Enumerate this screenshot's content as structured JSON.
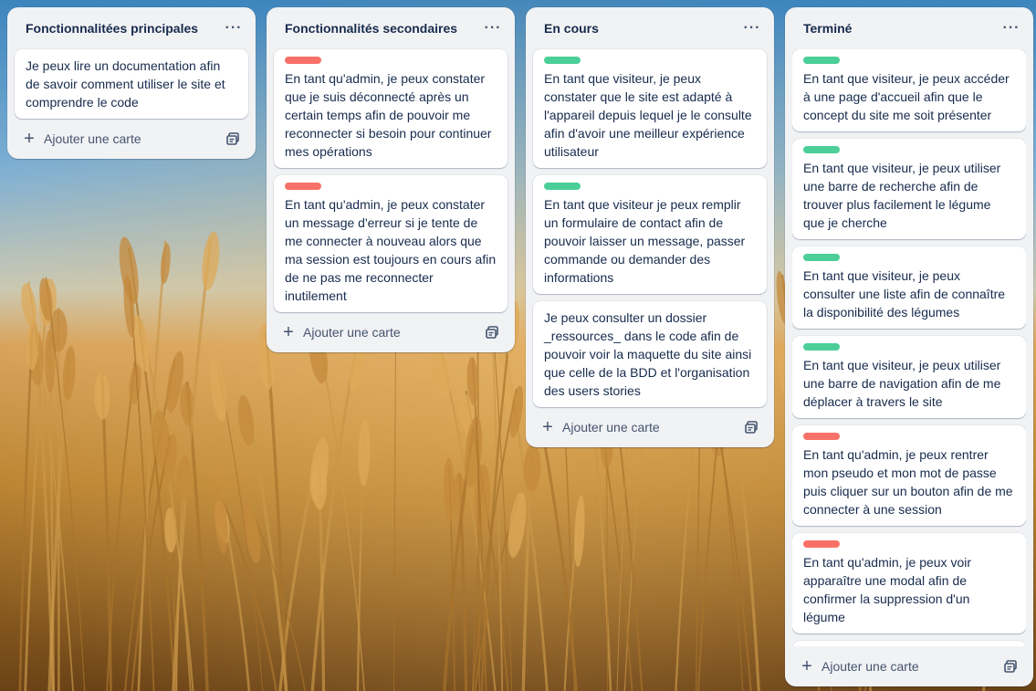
{
  "board": {
    "add_card_label": "Ajouter une carte",
    "menu_glyph": "···",
    "label_colors": {
      "red": "#f87168",
      "green": "#4bce97"
    }
  },
  "lists": [
    {
      "title": "Fonctionnalitées principales",
      "cards": [
        {
          "label": null,
          "text": "Je peux lire un documentation afin de savoir comment utiliser le site et comprendre le code"
        }
      ]
    },
    {
      "title": "Fonctionnalités secondaires",
      "cards": [
        {
          "label": "red",
          "text": "En tant qu'admin, je peux constater que je suis déconnecté après un certain temps afin de pouvoir me reconnecter si besoin pour continuer mes opérations"
        },
        {
          "label": "red",
          "text": "En tant qu'admin, je peux constater un message d'erreur si je tente de me connecter à nouveau alors que ma session est toujours en cours afin de ne pas me reconnecter inutilement"
        }
      ]
    },
    {
      "title": "En cours",
      "cards": [
        {
          "label": "green",
          "text": "En tant que visiteur, je peux constater que le site est adapté à l'appareil depuis lequel je le consulte afin d'avoir une meilleur expérience utilisateur"
        },
        {
          "label": "green",
          "text": "En tant que visiteur je peux remplir un formulaire de contact afin de pouvoir laisser un message, passer commande ou demander des informations"
        },
        {
          "label": null,
          "text": "Je peux consulter un dossier _ressources_ dans le code afin de pouvoir voir la maquette du site ainsi que celle de la BDD et l'organisation des users stories"
        }
      ]
    },
    {
      "title": "Terminé",
      "cards": [
        {
          "label": "green",
          "text": "En tant que visiteur, je peux accéder à une page d'accueil afin que le concept du site me soit présenter"
        },
        {
          "label": "green",
          "text": "En tant que visiteur, je peux utiliser une barre de recherche afin de trouver plus facilement le légume que je cherche"
        },
        {
          "label": "green",
          "text": "En tant que visiteur, je peux consulter une liste afin de connaître la disponibilité des légumes"
        },
        {
          "label": "green",
          "text": "En tant que visiteur, je peux utiliser une barre de navigation afin de me déplacer à travers le site"
        },
        {
          "label": "red",
          "text": "En tant qu'admin, je peux rentrer mon pseudo et mon mot de passe puis cliquer sur un bouton afin de me connecter à une session"
        },
        {
          "label": "red",
          "text": "En tant qu'admin, je peux voir apparaître une modal afin de confirmer la suppression d'un légume"
        },
        {
          "label": "red",
          "text": ""
        }
      ]
    }
  ]
}
